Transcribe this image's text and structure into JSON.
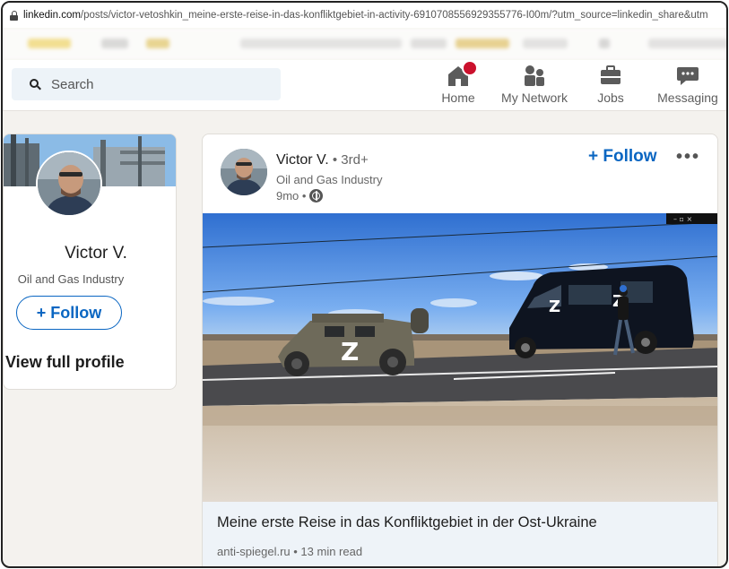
{
  "browser": {
    "url_host": "linkedin.com",
    "url_path": "/posts/victor-vetoshkin_meine-erste-reise-in-das-konfliktgebiet-in-activity-6910708556929355776-I00m/?utm_source=linkedin_share&utm"
  },
  "nav": {
    "search_placeholder": "Search",
    "items": [
      {
        "label": "Home",
        "icon": "home-icon"
      },
      {
        "label": "My Network",
        "icon": "network-icon"
      },
      {
        "label": "Jobs",
        "icon": "briefcase-icon"
      },
      {
        "label": "Messaging",
        "icon": "messaging-icon"
      }
    ]
  },
  "profile_card": {
    "name": "Victor V.",
    "headline": "Oil and Gas Industry",
    "follow_label": "+ Follow",
    "view_profile_label": "View full profile"
  },
  "post": {
    "author_name": "Victor V.",
    "degree": " • 3rd+",
    "headline": "Oil and Gas Industry",
    "time": "9mo •",
    "follow_label": "+ Follow",
    "more_label": "•••",
    "article_title": "Meine erste Reise in das Konfliktgebiet in der Ost-Ukraine",
    "article_meta": "anti-spiegel.ru • 13 min read",
    "vehicle_marks": [
      "Z",
      "Z",
      "Z"
    ]
  },
  "colors": {
    "linkedin_blue": "#0a66c2",
    "notification_red": "#cb112d"
  }
}
